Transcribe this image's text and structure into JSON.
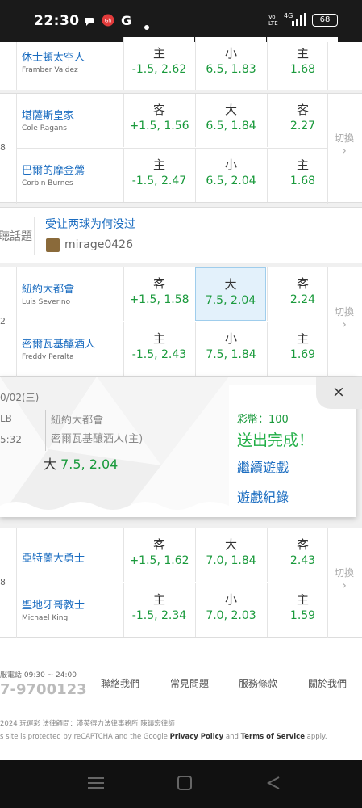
{
  "status": {
    "time": "22:30",
    "battery": "68"
  },
  "match1": {
    "away": {
      "zh": "休士頓太空人",
      "en": "Framber Valdez",
      "spread_label": "主",
      "spread": "-1.5, 2.62",
      "total_label": "小",
      "total": "6.5, 1.83",
      "ml_label": "主",
      "ml": "1.68"
    }
  },
  "match2": {
    "side_no": "8",
    "switch_label": "切換",
    "away": {
      "zh": "堪薩斯皇家",
      "en": "Cole Ragans",
      "spread_label": "客",
      "spread": "+1.5, 1.56",
      "total_label": "大",
      "total": "6.5, 1.84",
      "ml_label": "客",
      "ml": "2.27"
    },
    "home": {
      "zh": "巴爾的摩金鶯",
      "en": "Corbin Burnes",
      "spread_label": "主",
      "spread": "-1.5, 2.47",
      "total_label": "小",
      "total": "6.5, 2.04",
      "ml_label": "主",
      "ml": "1.68"
    }
  },
  "topic": {
    "side_label": "聴話題",
    "text": "受让两球为何没过",
    "user": "mirage0426"
  },
  "match3": {
    "side_no": "2",
    "switch_label": "切換",
    "away": {
      "zh": "紐約大都會",
      "en": "Luis Severino",
      "spread_label": "客",
      "spread": "+1.5, 1.58",
      "total_label": "大",
      "total": "7.5, 2.04",
      "ml_label": "客",
      "ml": "2.24"
    },
    "home": {
      "zh": "密爾瓦基釀酒人",
      "en": "Freddy Peralta",
      "spread_label": "主",
      "spread": "-1.5, 2.43",
      "total_label": "小",
      "total": "7.5, 1.84",
      "ml_label": "主",
      "ml": "1.69"
    }
  },
  "popup": {
    "date": "0/02(三)",
    "league": "LB",
    "time": "5:32",
    "team_away": "紐約大都會",
    "team_home": "密爾瓦基釀酒人(主)",
    "bet_label": "大",
    "bet_value": "7.5, 2.04",
    "coins": "彩幣：100",
    "done": "送出完成！",
    "continue": "繼續遊戲",
    "records": "遊戲紀錄",
    "close": "×"
  },
  "match4": {
    "side_no": "8",
    "switch_label": "切換",
    "away": {
      "zh": "亞特蘭大勇士",
      "en": "",
      "spread_label": "客",
      "spread": "+1.5, 1.62",
      "total_label": "大",
      "total": "7.0, 1.84",
      "ml_label": "客",
      "ml": "2.43"
    },
    "home": {
      "zh": "聖地牙哥教士",
      "en": "Michael King",
      "spread_label": "主",
      "spread": "-1.5, 2.34",
      "total_label": "小",
      "total": "7.0, 2.03",
      "ml_label": "主",
      "ml": "1.59"
    }
  },
  "footer": {
    "hotline_label": "服電話 09:30 ~ 24:00",
    "phone": "7-9700123",
    "links": [
      "聯絡我們",
      "常見問題",
      "服務條款",
      "關於我們"
    ],
    "copyright": "2024 玩運彩 法律顧問：漢英得力法律事務所 陳鎮宏律師",
    "recaptcha_pre": "s site is protected by reCAPTCHA and the Google ",
    "privacy": "Privacy Policy",
    "and": " and ",
    "terms": "Terms of Service",
    "apply": " apply."
  }
}
